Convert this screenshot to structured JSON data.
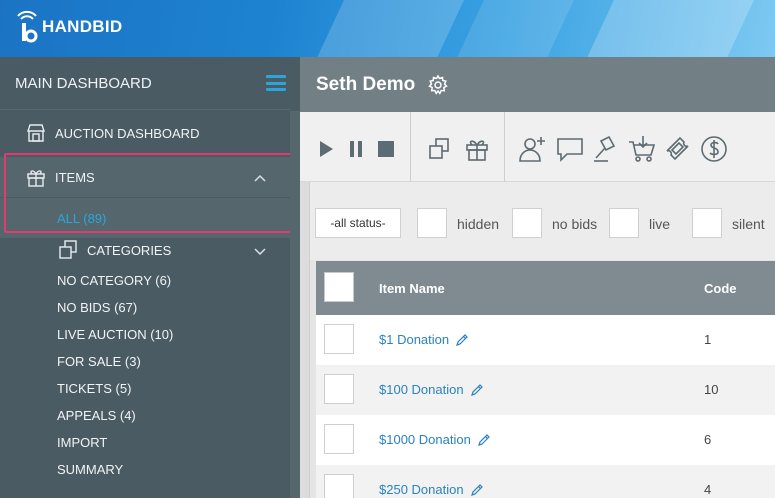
{
  "brand": {
    "name": "HANDBID"
  },
  "sidebar": {
    "header": "MAIN DASHBOARD",
    "auction_dashboard": "AUCTION DASHBOARD",
    "items": "ITEMS",
    "all": "ALL (89)",
    "categories": "CATEGORIES",
    "subitems": [
      "NO CATEGORY (6)",
      "NO BIDS (67)",
      "LIVE AUCTION (10)",
      "FOR SALE (3)",
      "TICKETS (5)",
      "APPEALS (4)",
      "IMPORT",
      "SUMMARY"
    ]
  },
  "topbar": {
    "title": "Seth Demo"
  },
  "toolbar": {
    "icons": [
      "play-icon",
      "pause-icon",
      "stop-icon",
      "clone-icon",
      "gift-icon",
      "add-user-icon",
      "message-icon",
      "gavel-icon",
      "cart-icon",
      "ticket-icon",
      "dollar-icon"
    ]
  },
  "filters": {
    "status": "-all status-",
    "checks": [
      "hidden",
      "no bids",
      "live",
      "silent"
    ]
  },
  "table": {
    "headers": {
      "name": "Item Name",
      "code": "Code"
    },
    "rows": [
      {
        "name": "$1 Donation",
        "code": "1"
      },
      {
        "name": "$100 Donation",
        "code": "10"
      },
      {
        "name": "$1000 Donation",
        "code": "6"
      },
      {
        "name": "$250 Donation",
        "code": "4"
      }
    ]
  },
  "colors": {
    "accent": "#2aa6db",
    "highlight": "#e23a6e",
    "sidebar": "#4b5b63",
    "link": "#2a82c0"
  }
}
